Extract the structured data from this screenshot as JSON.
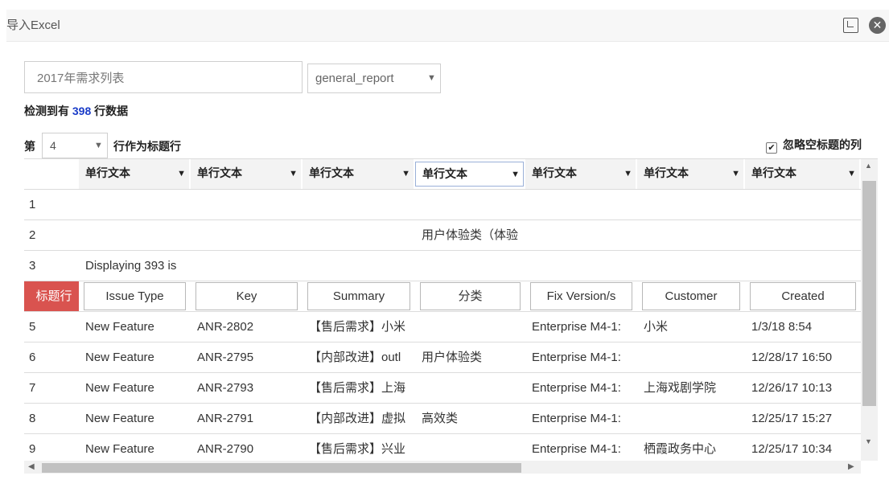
{
  "dialog": {
    "title": "导入Excel"
  },
  "form": {
    "table_name": "2017年需求列表",
    "sheet_select": "general_report",
    "detect_prefix": "检测到有",
    "detect_count": "398",
    "detect_suffix": "行数据",
    "header_prefix": "第",
    "header_row": "4",
    "header_suffix": "行作为标题行",
    "ignore_label": "忽略空标题的列",
    "ignore_checked": true
  },
  "grid": {
    "column_types": [
      "单行文本",
      "单行文本",
      "单行文本",
      "单行文本",
      "单行文本",
      "单行文本",
      "单行文本"
    ],
    "rows": [
      {
        "num": "1",
        "cells": [
          "",
          "",
          "",
          "",
          "",
          "",
          ""
        ]
      },
      {
        "num": "2",
        "cells": [
          "",
          "",
          "",
          "用户体验类（体验",
          "",
          "",
          ""
        ]
      },
      {
        "num": "3",
        "cells": [
          "Displaying 393 is",
          "",
          "",
          "",
          "",
          "",
          ""
        ]
      },
      {
        "num": "标题行",
        "is_header": true,
        "cells": [
          "Issue Type",
          "Key",
          "Summary",
          "分类",
          "Fix Version/s",
          "Customer",
          "Created"
        ]
      },
      {
        "num": "5",
        "cells": [
          "New Feature",
          "ANR-2802",
          "【售后需求】小米",
          "",
          "Enterprise M4-1:",
          "小米",
          "1/3/18 8:54"
        ]
      },
      {
        "num": "6",
        "cells": [
          "New Feature",
          "ANR-2795",
          "【内部改进】outl",
          "用户体验类",
          "Enterprise M4-1:",
          "",
          "12/28/17 16:50"
        ]
      },
      {
        "num": "7",
        "cells": [
          "New Feature",
          "ANR-2793",
          "【售后需求】上海",
          "",
          "Enterprise M4-1:",
          "上海戏剧学院",
          "12/26/17 10:13"
        ]
      },
      {
        "num": "8",
        "cells": [
          "New Feature",
          "ANR-2791",
          "【内部改进】虚拟",
          "高效类",
          "Enterprise M4-1:",
          "",
          "12/25/17 15:27"
        ]
      },
      {
        "num": "9",
        "cells": [
          "New Feature",
          "ANR-2790",
          "【售后需求】兴业",
          "",
          "Enterprise M4-1:",
          "栖霞政务中心",
          "12/25/17 10:34"
        ]
      }
    ]
  },
  "colors": {
    "header_tag": "#d9534f",
    "count": "#1a3cc8"
  },
  "icons": [
    "maximize-icon",
    "close-icon",
    "dropdown-caret-icon",
    "checkbox-check-icon",
    "scroll-up-icon",
    "scroll-down-icon",
    "scroll-left-icon",
    "scroll-right-icon"
  ]
}
